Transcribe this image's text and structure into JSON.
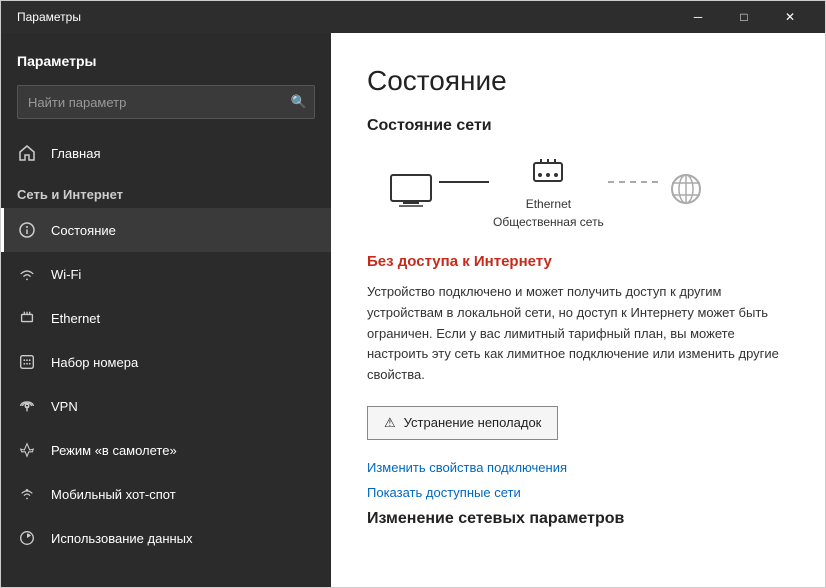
{
  "window": {
    "title": "Параметры"
  },
  "titlebar": {
    "minimize": "─",
    "maximize": "□",
    "close": "✕"
  },
  "sidebar": {
    "header": "Параметры",
    "search_placeholder": "Найти параметр",
    "section_label": "Сеть и Интернет",
    "items": [
      {
        "id": "home",
        "label": "Главная",
        "icon": "home-icon"
      },
      {
        "id": "status",
        "label": "Состояние",
        "icon": "status-icon",
        "active": true
      },
      {
        "id": "wifi",
        "label": "Wi-Fi",
        "icon": "wifi-icon"
      },
      {
        "id": "ethernet",
        "label": "Ethernet",
        "icon": "ethernet-icon"
      },
      {
        "id": "dialup",
        "label": "Набор номера",
        "icon": "dialup-icon"
      },
      {
        "id": "vpn",
        "label": "VPN",
        "icon": "vpn-icon"
      },
      {
        "id": "airplane",
        "label": "Режим «в самолете»",
        "icon": "airplane-icon"
      },
      {
        "id": "hotspot",
        "label": "Мобильный хот-спот",
        "icon": "hotspot-icon"
      },
      {
        "id": "datausage",
        "label": "Использование данных",
        "icon": "datausage-icon"
      }
    ]
  },
  "main": {
    "title": "Состояние",
    "network_status_label": "Состояние сети",
    "ethernet_label": "Ethernet",
    "network_type_label": "Общественная сеть",
    "no_internet_title": "Без доступа к Интернету",
    "description": "Устройство подключено и может получить доступ к другим устройствам в локальной сети, но доступ к Интернету может быть ограничен. Если у вас лимитный тарифный план, вы можете настроить эту сеть как лимитное подключение или изменить другие свойства.",
    "troubleshoot_btn": "Устранение неполадок",
    "link_change": "Изменить свойства подключения",
    "link_available": "Показать доступные сети",
    "change_settings_title": "Изменение сетевых параметров"
  }
}
